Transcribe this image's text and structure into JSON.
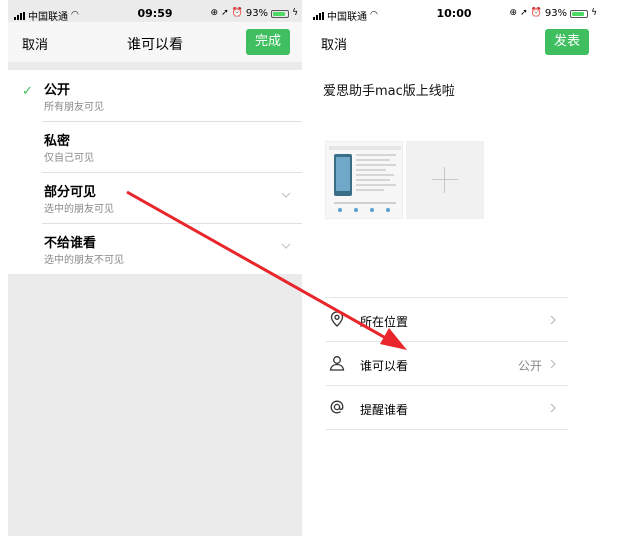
{
  "left_screen": {
    "status_bar": {
      "carrier": "中国联通",
      "time": "09:59",
      "battery": "93%"
    },
    "nav": {
      "cancel": "取消",
      "title": "谁可以看",
      "done": "完成"
    },
    "options": [
      {
        "title": "公开",
        "subtitle": "所有朋友可见",
        "selected": true
      },
      {
        "title": "私密",
        "subtitle": "仅自己可见"
      },
      {
        "title": "部分可见",
        "subtitle": "选中的朋友可见"
      },
      {
        "title": "不给谁看",
        "subtitle": "选中的朋友不可见"
      }
    ]
  },
  "right_screen": {
    "status_bar": {
      "carrier": "中国联通",
      "time": "10:00",
      "battery": "93%"
    },
    "nav": {
      "cancel": "取消",
      "publish": "发表"
    },
    "compose_text": "爱思助手mac版上线啦",
    "settings": [
      {
        "label": "所在位置",
        "value": "",
        "icon": "location-icon"
      },
      {
        "label": "谁可以看",
        "value": "公开",
        "icon": "person-icon"
      },
      {
        "label": "提醒谁看",
        "value": "",
        "icon": "at-icon"
      }
    ]
  },
  "colors": {
    "accent_green": "#3fbf5f",
    "arrow_red": "#e8262b",
    "battery_green": "#4cd964"
  }
}
